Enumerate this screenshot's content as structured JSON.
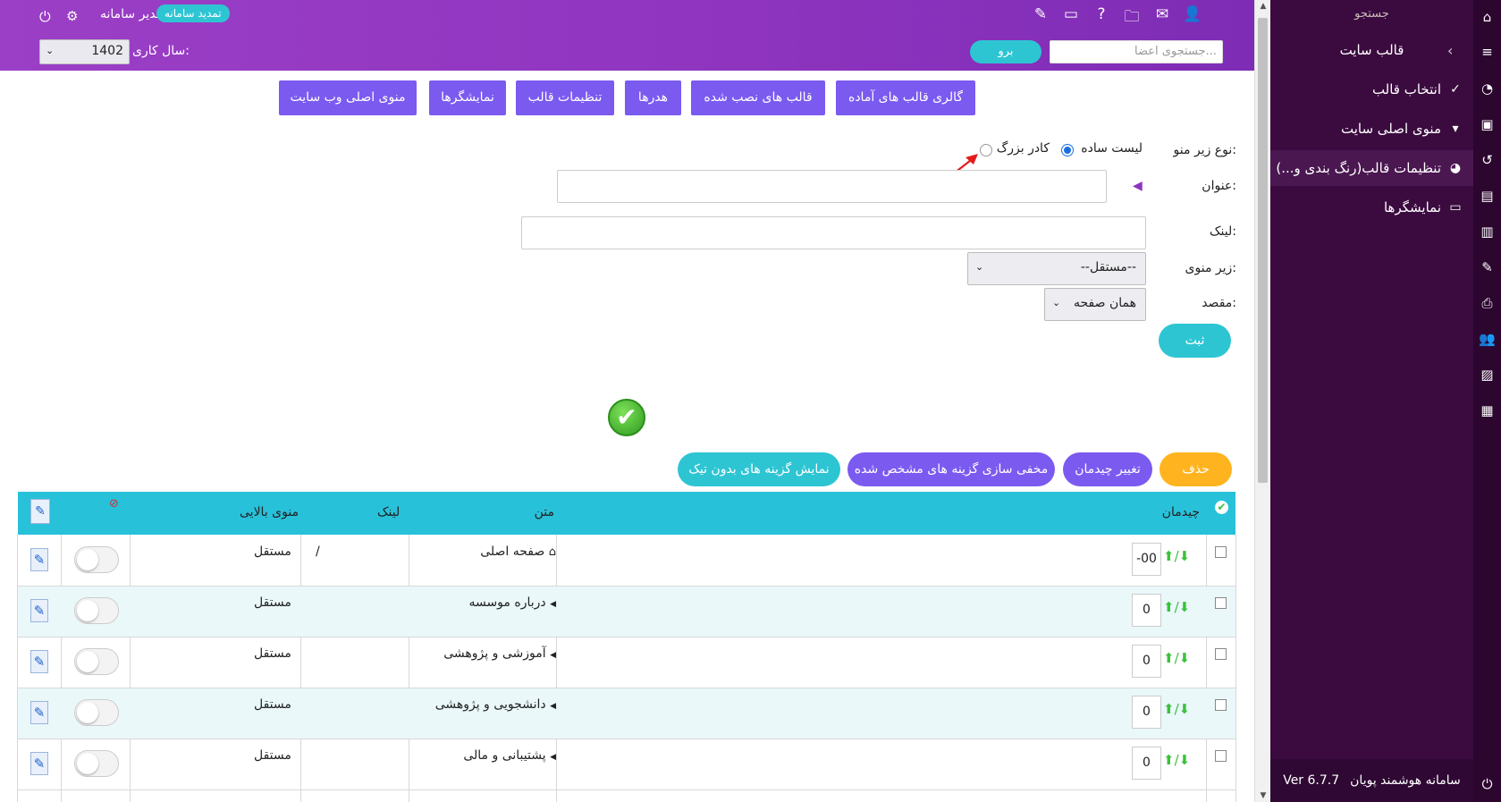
{
  "header": {
    "renew_label": "تمدید سامانه",
    "admin_name": "مدیر سامانه",
    "year_label": "سال کاری:",
    "year_value": "1402",
    "search_placeholder": "جستجوی اعضا...",
    "go_label": "برو",
    "icons": [
      "power-icon",
      "gears-icon",
      "user-plus-icon",
      "mail-icon",
      "folder-icon",
      "help-icon",
      "ticket-icon",
      "edit-icon"
    ]
  },
  "sidebar": {
    "search_placeholder": "جستجو",
    "section_title": "قالب سایت",
    "items": [
      {
        "label": "انتخاب قالب",
        "icon": "check-circle-icon"
      },
      {
        "label": "منوی اصلی سایت",
        "icon": "caret-box-icon"
      },
      {
        "label": "تنظیمات قالب(رنگ بندی و...)",
        "icon": "palette-icon"
      },
      {
        "label": "نمایشگرها",
        "icon": "monitor-icon"
      }
    ],
    "footer_name": "سامانه هوشمند پویان",
    "footer_version": "Ver 6.7.7"
  },
  "tabs": [
    "گالری قالب های آماده",
    "قالب های نصب شده",
    "هدرها",
    "تنظیمات قالب",
    "نمایشگرها",
    "منوی اصلی وب سایت"
  ],
  "form": {
    "submenu_type_label": "نوع زیر منو:",
    "option_simple": "لیست ساده",
    "option_big": "کادر بزرگ",
    "title_label": "عنوان:",
    "link_label": "لینک:",
    "submenu_label": "زیر منوی:",
    "submenu_value": "--مستقل--",
    "target_label": "مقصد:",
    "target_value": "همان صفحه",
    "submit_label": "ثبت"
  },
  "actions": {
    "delete": "حذف",
    "change_layout": "تغییر چیدمان",
    "hide_selected": "مخفی سازی گزینه های مشخص شده",
    "show_unchecked": "نمایش گزینه های بدون تیک"
  },
  "table": {
    "headers": {
      "layout": "چیدمان",
      "text": "متن",
      "link": "لینک",
      "parent": "منوی بالایی"
    },
    "rows": [
      {
        "order": "-00",
        "text": "صفحه اصلی",
        "link": "/",
        "parent": "مستقل"
      },
      {
        "order": "0",
        "text": "درباره موسسه",
        "link": "",
        "parent": "مستقل"
      },
      {
        "order": "0",
        "text": "آموزشی و پژوهشی",
        "link": "",
        "parent": "مستقل"
      },
      {
        "order": "0",
        "text": "دانشجویی و پژوهشی",
        "link": "",
        "parent": "مستقل"
      },
      {
        "order": "0",
        "text": "پشتیبانی و مالی",
        "link": "",
        "parent": "مستقل"
      }
    ]
  },
  "colors": {
    "header_purple": "#9b3fc6",
    "sidebar_dark": "#3b0b3f",
    "tab_violet": "#7b5af0",
    "accent_cyan": "#2ec5d3",
    "delete_orange": "#ffb41f"
  }
}
